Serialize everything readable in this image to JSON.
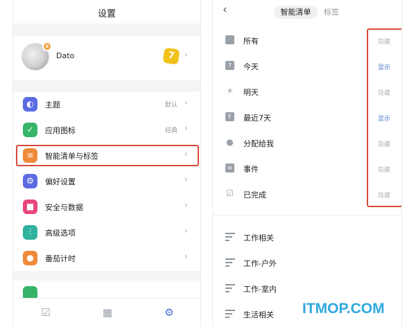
{
  "left": {
    "title": "设置",
    "profile": {
      "name": "Dato",
      "level": "7"
    },
    "menu": [
      {
        "label": "主题",
        "value": "默认",
        "icon": "palette-icon",
        "color": "#5b6ce2"
      },
      {
        "label": "应用图标",
        "value": "经典",
        "icon": "check-circle-icon",
        "color": "#35b46a"
      },
      {
        "label": "智能清单与标签",
        "value": "",
        "icon": "smart-list-icon",
        "color": "#ee8a3a"
      },
      {
        "label": "偏好设置",
        "value": "",
        "icon": "gear-icon",
        "color": "#5b6ce2"
      },
      {
        "label": "安全与数据",
        "value": "",
        "icon": "lock-icon",
        "color": "#e8467a"
      },
      {
        "label": "高级选项",
        "value": "",
        "icon": "sliders-icon",
        "color": "#2fb3a0"
      },
      {
        "label": "番茄计时",
        "value": "",
        "icon": "pomodoro-icon",
        "color": "#ee8a3a"
      }
    ],
    "tabbar": [
      "checkbox-icon",
      "calendar-icon",
      "gear-icon"
    ],
    "accent": "#d84a3a"
  },
  "right": {
    "tabs": {
      "active": "智能清单",
      "inactive": "标签"
    },
    "smart_lists": [
      {
        "label": "所有",
        "state": "隐藏",
        "icon": "inbox-icon"
      },
      {
        "label": "今天",
        "state": "显示",
        "icon": "calendar-today-icon",
        "icon_text": "7"
      },
      {
        "label": "明天",
        "state": "隐藏",
        "icon": "sunrise-icon"
      },
      {
        "label": "最近7天",
        "state": "显示",
        "icon": "calendar-week-icon",
        "icon_text": "F"
      },
      {
        "label": "分配给我",
        "state": "隐藏",
        "icon": "person-icon"
      },
      {
        "label": "事件",
        "state": "隐藏",
        "icon": "feed-icon"
      },
      {
        "label": "已完成",
        "state": "隐藏",
        "icon": "checkbox-icon"
      }
    ],
    "tags": [
      {
        "label": "工作相关"
      },
      {
        "label": "工作-户外"
      },
      {
        "label": "工作-室内"
      },
      {
        "label": "生活相关"
      }
    ],
    "show_color": "#4a78c8",
    "hide_color": "#b8b8b8"
  },
  "watermark": "ITMOP.COM"
}
